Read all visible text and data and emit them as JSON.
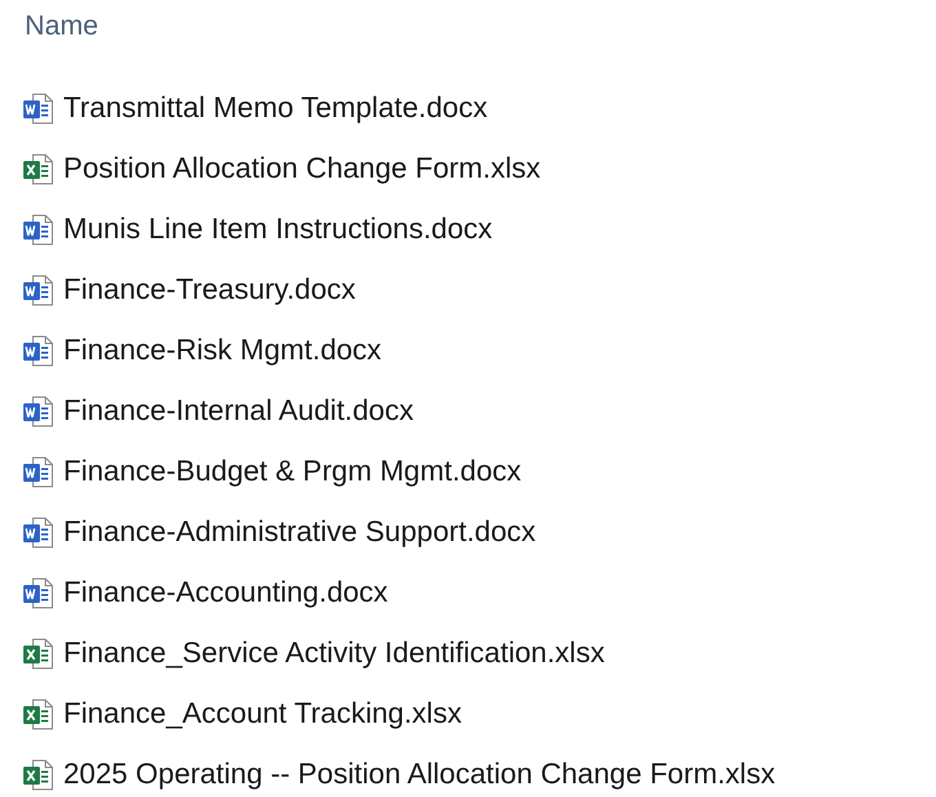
{
  "header": {
    "label": "Name"
  },
  "files": [
    {
      "name": "Transmittal Memo Template.docx",
      "kind": "word"
    },
    {
      "name": "Position Allocation Change Form.xlsx",
      "kind": "excel"
    },
    {
      "name": "Munis Line Item Instructions.docx",
      "kind": "word"
    },
    {
      "name": "Finance-Treasury.docx",
      "kind": "word"
    },
    {
      "name": "Finance-Risk Mgmt.docx",
      "kind": "word"
    },
    {
      "name": "Finance-Internal Audit.docx",
      "kind": "word"
    },
    {
      "name": "Finance-Budget & Prgm Mgmt.docx",
      "kind": "word"
    },
    {
      "name": "Finance-Administrative Support.docx",
      "kind": "word"
    },
    {
      "name": "Finance-Accounting.docx",
      "kind": "word"
    },
    {
      "name": "Finance_Service Activity Identification.xlsx",
      "kind": "excel"
    },
    {
      "name": "Finance_Account Tracking.xlsx",
      "kind": "excel"
    },
    {
      "name": "2025 Operating -- Position Allocation Change Form.xlsx",
      "kind": "excel"
    }
  ]
}
